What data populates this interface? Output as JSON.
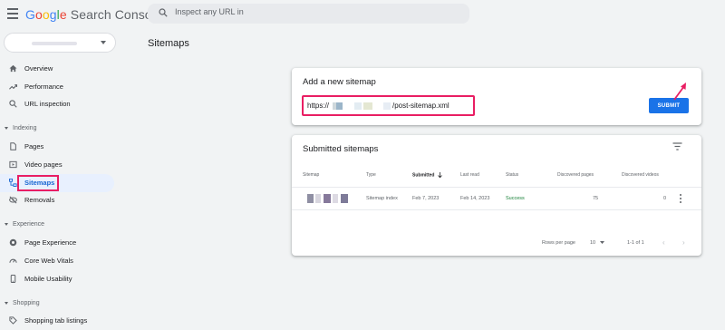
{
  "header": {
    "logo": {
      "g": "G",
      "o1": "o",
      "o2": "o",
      "g2": "g",
      "l": "l",
      "e": "e",
      "rest": " Search Console"
    },
    "search_placeholder": "Inspect any URL in"
  },
  "sidebar": {
    "items": [
      {
        "label": "Overview"
      },
      {
        "label": "Performance"
      },
      {
        "label": "URL inspection"
      }
    ],
    "sections": {
      "indexing": {
        "title": "Indexing",
        "items": [
          {
            "label": "Pages"
          },
          {
            "label": "Video pages"
          },
          {
            "label": "Sitemaps"
          },
          {
            "label": "Removals"
          }
        ]
      },
      "experience": {
        "title": "Experience",
        "items": [
          {
            "label": "Page Experience"
          },
          {
            "label": "Core Web Vitals"
          },
          {
            "label": "Mobile Usability"
          }
        ]
      },
      "shopping": {
        "title": "Shopping",
        "items": [
          {
            "label": "Shopping tab listings"
          }
        ]
      }
    }
  },
  "main": {
    "title": "Sitemaps",
    "add_card": {
      "title": "Add a new sitemap",
      "url_prefix": "https://",
      "url_suffix": "/post-sitemap.xml",
      "submit_label": "SUBMIT"
    },
    "submitted_card": {
      "title": "Submitted sitemaps",
      "columns": [
        "Sitemap",
        "Type",
        "Submitted",
        "Last read",
        "Status",
        "Discovered pages",
        "Discovered videos"
      ],
      "rows": [
        {
          "type": "Sitemap index",
          "submitted": "Feb 7, 2023",
          "last_read": "Feb 14, 2023",
          "status": "Success",
          "pages": "75",
          "videos": "0"
        }
      ],
      "footer": {
        "rows_per_page_label": "Rows per page",
        "rows_per_page_value": "10",
        "range": "1-1 of 1"
      }
    }
  },
  "colors": {
    "accent": "#1a73e8",
    "highlight": "#e91e63",
    "success": "#188038",
    "active_bg": "#e8f0fe"
  }
}
